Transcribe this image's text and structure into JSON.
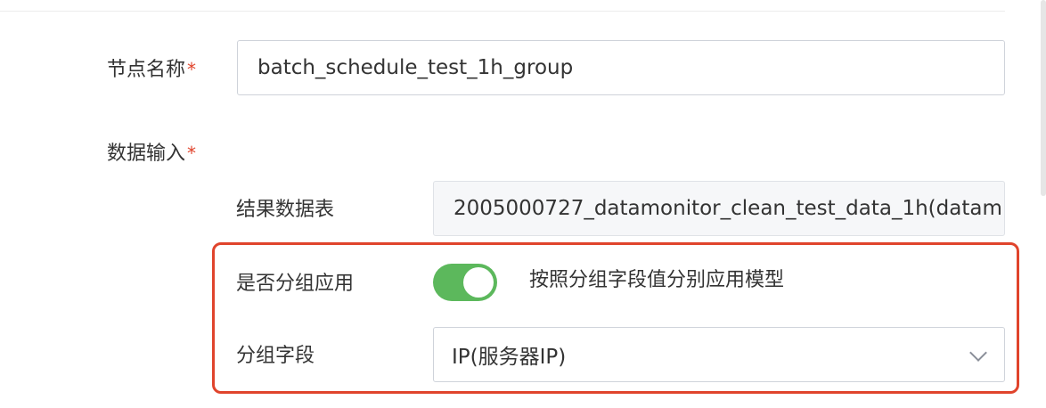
{
  "node_name": {
    "label": "节点名称",
    "required_mark": "*",
    "value": "batch_schedule_test_1h_group"
  },
  "data_input": {
    "label": "数据输入",
    "required_mark": "*",
    "result_table": {
      "label": "结果数据表",
      "value": "2005000727_datamonitor_clean_test_data_1h(datam"
    }
  },
  "group_apply": {
    "label": "是否分组应用",
    "enabled": true,
    "description": "按照分组字段值分别应用模型"
  },
  "group_field": {
    "label": "分组字段",
    "selected": "IP(服务器IP)"
  },
  "colors": {
    "toggle_on": "#5cb85c",
    "highlight_border": "#e0442c",
    "required": "#e0442c"
  }
}
